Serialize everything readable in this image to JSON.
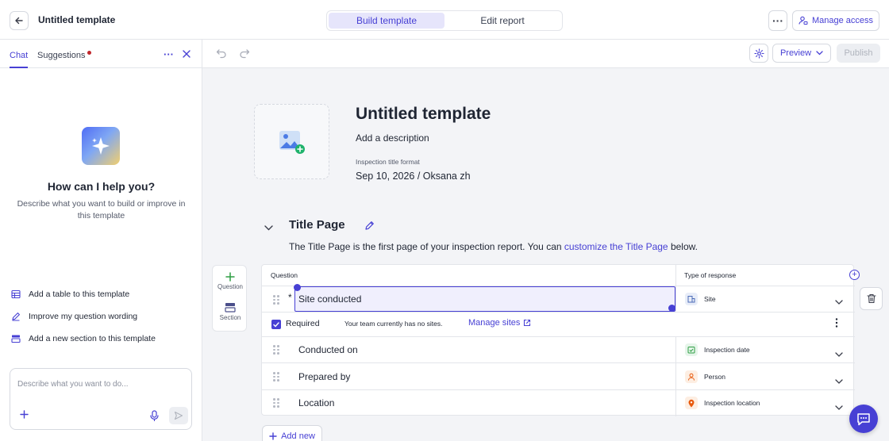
{
  "topbar": {
    "title": "Untitled template",
    "tabs": [
      {
        "label": "Build template",
        "active": true
      },
      {
        "label": "Edit report",
        "active": false
      }
    ],
    "more_label": "···",
    "manage_access_label": "Manage access"
  },
  "left_panel": {
    "tabs": [
      {
        "label": "Chat",
        "active": true
      },
      {
        "label": "Suggestions",
        "has_notification": true
      }
    ],
    "more_label": "···",
    "help_title": "How can I help you?",
    "help_desc": "Describe what you want to build or improve in this template",
    "suggestions": [
      {
        "label": "Add a table to this template",
        "icon": "table-icon"
      },
      {
        "label": "Improve my question wording",
        "icon": "pencil-icon"
      },
      {
        "label": "Add a new section to this template",
        "icon": "section-icon"
      }
    ],
    "chat_placeholder": "Describe what you want to do..."
  },
  "toolbar": {
    "preview_label": "Preview",
    "publish_label": "Publish"
  },
  "template": {
    "title": "Untitled template",
    "description": "Add a description",
    "inspection_format_label": "Inspection title format",
    "inspection_format_value": "Sep 10, 2026 / Oksana zh"
  },
  "section": {
    "title": "Title Page",
    "desc_prefix": "The Title Page is the first page of your inspection report. You can ",
    "desc_link": "customize the Title Page",
    "desc_suffix": " below."
  },
  "add_tools": {
    "question_label": "Question",
    "section_label": "Section"
  },
  "table": {
    "headers": {
      "question": "Question",
      "response": "Type of response"
    },
    "rows": [
      {
        "question": "Site conducted",
        "required": true,
        "response": "Site",
        "response_icon": "site-icon",
        "icon_color": "#4b6cb7",
        "icon_bg": "#e8edf8"
      },
      {
        "question": "Conducted on",
        "response": "Inspection date",
        "response_icon": "calendar-check-icon",
        "icon_color": "#2f9e44",
        "icon_bg": "#e6f5ea"
      },
      {
        "question": "Prepared by",
        "response": "Person",
        "response_icon": "person-icon",
        "icon_color": "#e8590c",
        "icon_bg": "#fdeee2"
      },
      {
        "question": "Location",
        "response": "Inspection location",
        "response_icon": "location-pin-icon",
        "icon_color": "#e8590c",
        "icon_bg": "#fdeee2"
      }
    ],
    "required_label": "Required",
    "sites_note": "Your team currently has no sites.",
    "manage_sites_label": "Manage sites"
  },
  "add_new_label": "Add new",
  "colors": {
    "accent": "#4740d4",
    "notification": "#c0262b"
  }
}
